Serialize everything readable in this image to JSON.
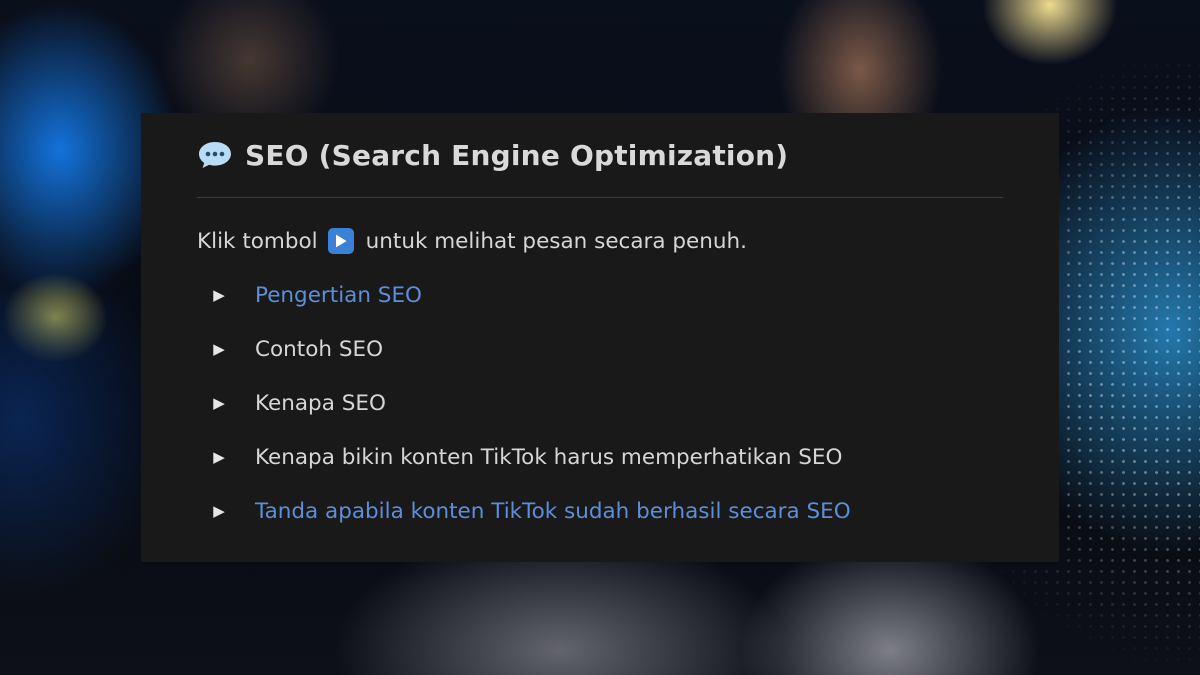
{
  "callout": {
    "icon": "speech-bubble-icon",
    "title": "SEO (Search Engine Optimization)",
    "intro_before": "Klik tombol",
    "intro_icon": "play-button-icon",
    "intro_after": "untuk melihat pesan secara penuh."
  },
  "toggles": [
    {
      "label": "Pengertian SEO",
      "highlighted": true
    },
    {
      "label": "Contoh SEO",
      "highlighted": false
    },
    {
      "label": "Kenapa SEO",
      "highlighted": false
    },
    {
      "label": "Kenapa bikin konten TikTok harus memperhatikan SEO",
      "highlighted": false
    },
    {
      "label": "Tanda apabila konten TikTok sudah berhasil secara SEO",
      "highlighted": true
    }
  ],
  "toggle_arrow_glyph": "▶",
  "colors": {
    "panel_background": "#191919",
    "link_text": "#5c8fd9",
    "play_button": "#3b82d6",
    "speech_icon": "#b8dcf5"
  }
}
